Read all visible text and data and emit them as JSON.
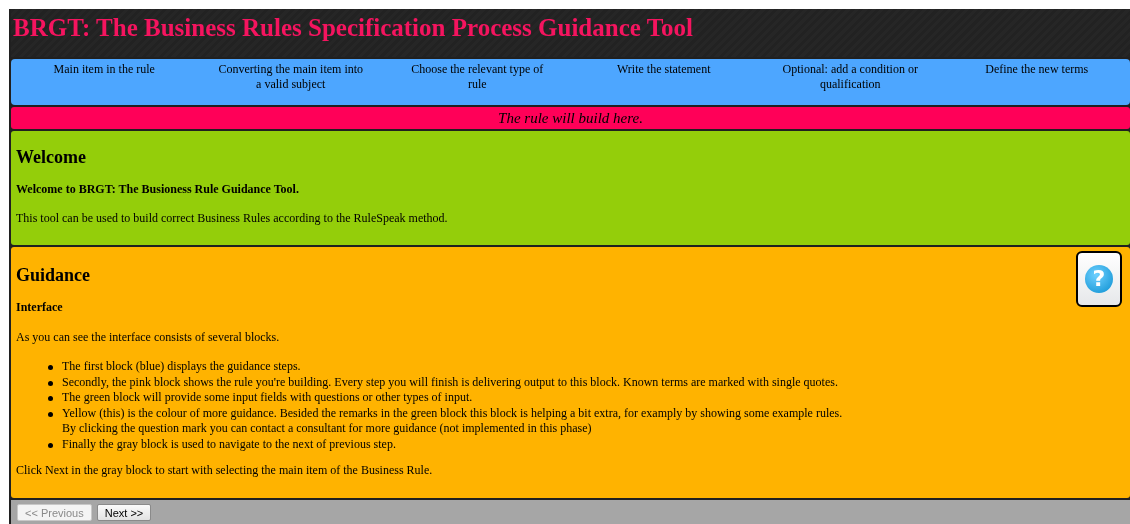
{
  "header": {
    "title": "BRGT: The Business Rules Specification Process Guidance Tool"
  },
  "steps": [
    "Main item in the rule",
    "Converting the main item into a valid subject",
    "Choose the relevant type of rule",
    "Write the statement",
    "Optional: add a condition or qualification",
    "Define the new terms"
  ],
  "rule_bar": {
    "text": "The rule will build here."
  },
  "welcome": {
    "heading": "Welcome",
    "subheading": "Welcome to BRGT: The Busioness Rule Guidance Tool.",
    "text": "This tool can be used to build correct Business Rules according to the RuleSpeak method."
  },
  "guidance": {
    "heading": "Guidance",
    "subheading": "Interface",
    "intro": "As you can see the interface consists of several blocks.",
    "items": [
      {
        "lines": [
          "The first block (blue) displays the guidance steps."
        ]
      },
      {
        "lines": [
          "Secondly, the pink block shows the rule you're building. Every step you will finish is delivering output to this block. Known terms are marked with single quotes."
        ]
      },
      {
        "lines": [
          "The green block will provide some input fields with questions or other types of input."
        ]
      },
      {
        "lines": [
          "Yellow (this) is the colour of more guidance. Besided the remarks in the green block this block is helping a bit extra, for examply by showing some example rules.",
          "By clicking the question mark you can contact a consultant for more guidance (not implemented in this phase)"
        ]
      },
      {
        "lines": [
          "Finally the gray block is used to navigate to the next of previous step."
        ]
      }
    ],
    "outro": "Click Next in the gray block to start with selecting the main item of the Business Rule.",
    "help_button": {
      "label": "?"
    }
  },
  "navigation": [
    {
      "label": "<< Previous",
      "disabled": true
    },
    {
      "label": "Next >>",
      "disabled": false
    }
  ]
}
